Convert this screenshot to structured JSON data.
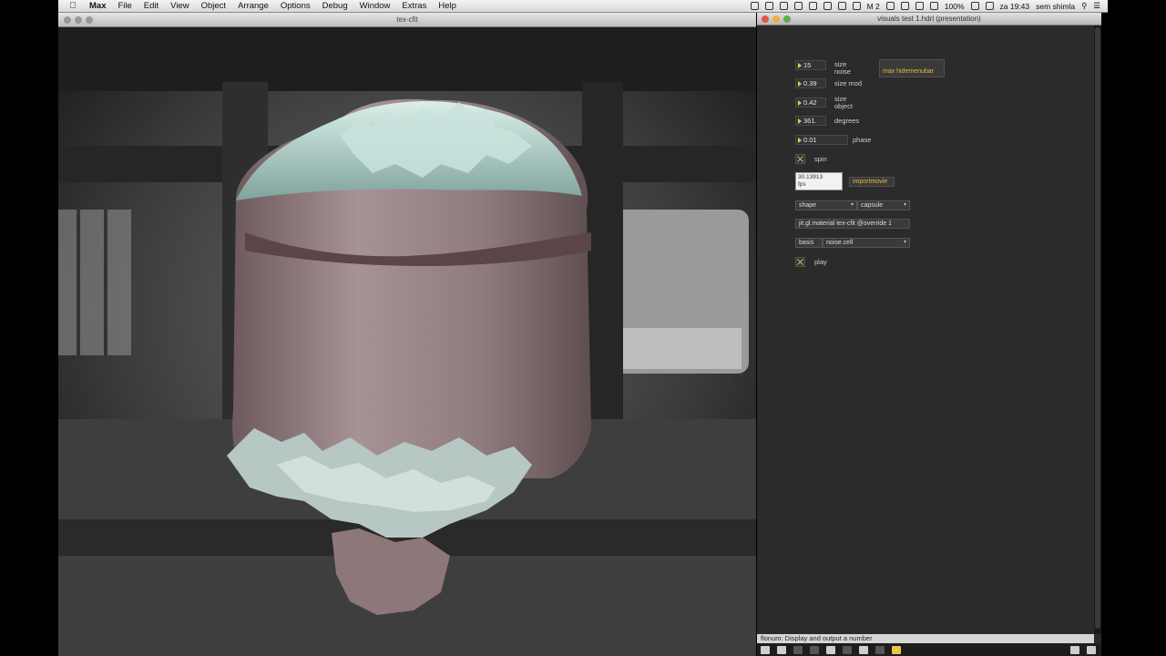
{
  "menubar": {
    "items": [
      "Max",
      "File",
      "Edit",
      "View",
      "Object",
      "Arrange",
      "Options",
      "Debug",
      "Window",
      "Extras",
      "Help"
    ],
    "status": {
      "m2": "M 2",
      "battery": "100%",
      "time": "za 19:43",
      "user": "sem shimla"
    }
  },
  "jit_window": {
    "title": "tex-cfit"
  },
  "patcher": {
    "title": "visuals test 1.hdrl (presentation)",
    "controls": {
      "size_noise": {
        "value": "15",
        "label_line1": "size",
        "label_line2": "noise"
      },
      "size_mod": {
        "value": "0.39",
        "label": "size mod"
      },
      "size_object": {
        "value": "0.42",
        "label_line1": "size",
        "label_line2": "object"
      },
      "degrees": {
        "value": "361.",
        "label": "degrees"
      },
      "phase": {
        "value": "0.01",
        "label": "phase"
      },
      "spin": {
        "label": "spin"
      },
      "hidemenubar": {
        "label": "max hidemenubar"
      },
      "fps": {
        "line1": "30.13913",
        "line2": "fps"
      },
      "importmovie": {
        "label": "importmovie"
      },
      "shape": {
        "label": "shape",
        "value": "capsule"
      },
      "material": {
        "label": "jit.gl.material tex-cfit @override 1"
      },
      "basis": {
        "label": "basis",
        "value": "noise.cell"
      },
      "play": {
        "label": "play"
      }
    },
    "status_text": "flonum: Display and output a number"
  }
}
